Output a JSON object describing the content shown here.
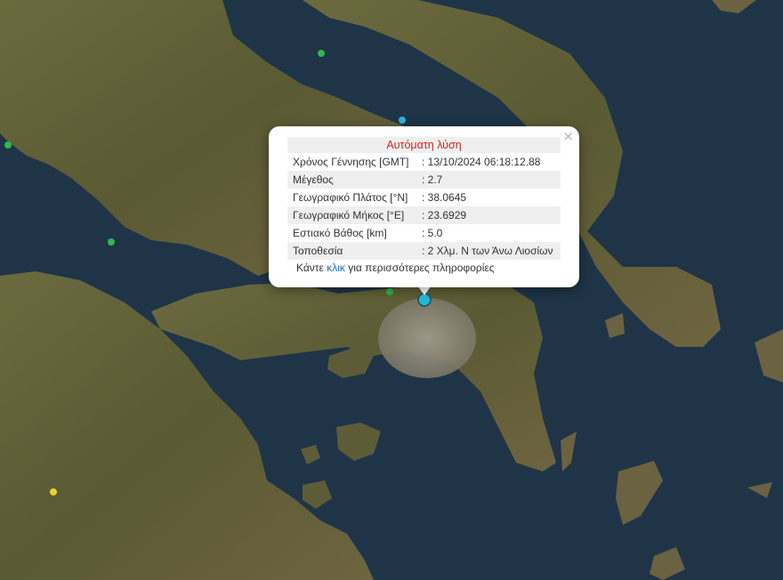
{
  "popup": {
    "title": "Αυτόματη λύση",
    "close_symbol": "×",
    "rows": [
      {
        "label": "Χρόνος Γέννησης [GMT]",
        "value": ": 13/10/2024 06:18:12.88"
      },
      {
        "label": "Μέγεθος",
        "value": ": 2.7"
      },
      {
        "label": "Γεωγραφικό Πλάτος [°N]",
        "value": ": 38.0645"
      },
      {
        "label": "Γεωγραφικό Μήκος [°E]",
        "value": ": 23.6929"
      },
      {
        "label": "Εστιακό Βάθος [km]",
        "value": ": 5.0"
      },
      {
        "label": "Τοποθεσία",
        "value": ": 2 Χλμ. Ν των Άνω Λιοσίων"
      }
    ],
    "more_prefix": "Κάντε ",
    "more_link": "κλικ",
    "more_suffix": " για περισσότερες πληροφορίες"
  },
  "colors": {
    "sea": "#1f3447",
    "land": "#5b5a35",
    "urban": "#8a8478",
    "marker_green": "#2eb84c",
    "marker_cyan": "#28b8d6",
    "marker_yellow": "#e8d22c",
    "title_red": "#d32020",
    "link_blue": "#1a6dcc"
  },
  "markers": [
    {
      "type": "selected-quake",
      "color": "cyan"
    },
    {
      "type": "quake",
      "color": "cyan"
    },
    {
      "type": "quake",
      "color": "green"
    },
    {
      "type": "quake",
      "color": "green"
    },
    {
      "type": "quake",
      "color": "green"
    },
    {
      "type": "quake",
      "color": "green"
    },
    {
      "type": "quake",
      "color": "yellow"
    }
  ]
}
